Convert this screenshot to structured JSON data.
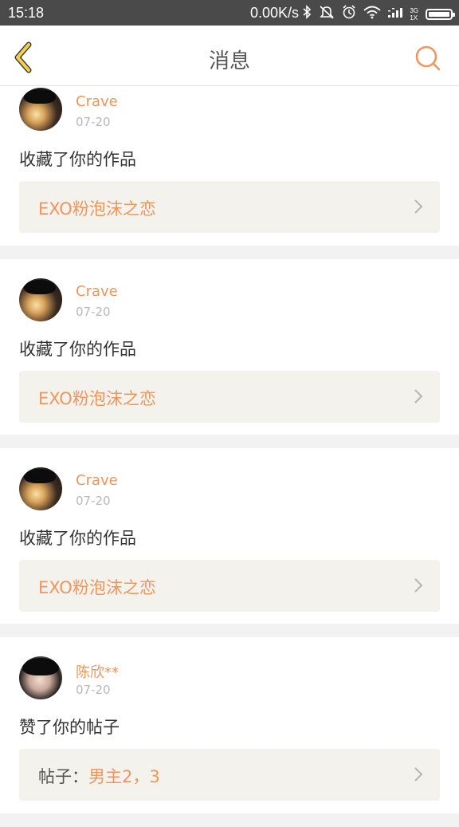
{
  "status_bar": {
    "time": "15:18",
    "speed": "0.00K/s",
    "network_top": "3G",
    "network_bottom": "1X",
    "icons": [
      "bluetooth-icon",
      "mute-icon",
      "alarm-icon",
      "wifi-icon",
      "signal-icon",
      "battery-icon"
    ]
  },
  "header": {
    "title": "消息"
  },
  "colors": {
    "accent": "#f0955c",
    "back_icon": "#f2d04b",
    "header_bg": "#ffffff",
    "page_bg": "#f2f2f2",
    "link_bg": "#f3f2ec"
  },
  "messages": [
    {
      "user": "Crave",
      "date": "07-20",
      "action": "收藏了你的作品",
      "link_prefix": "",
      "link_text": "EXO粉泡沫之恋"
    },
    {
      "user": "Crave",
      "date": "07-20",
      "action": "收藏了你的作品",
      "link_prefix": "",
      "link_text": "EXO粉泡沫之恋"
    },
    {
      "user": "Crave",
      "date": "07-20",
      "action": "收藏了你的作品",
      "link_prefix": "",
      "link_text": "EXO粉泡沫之恋"
    },
    {
      "user": "陈欣**",
      "date": "07-20",
      "action": "赞了你的帖子",
      "link_prefix": "帖子：",
      "link_text": "男主2，3"
    }
  ]
}
